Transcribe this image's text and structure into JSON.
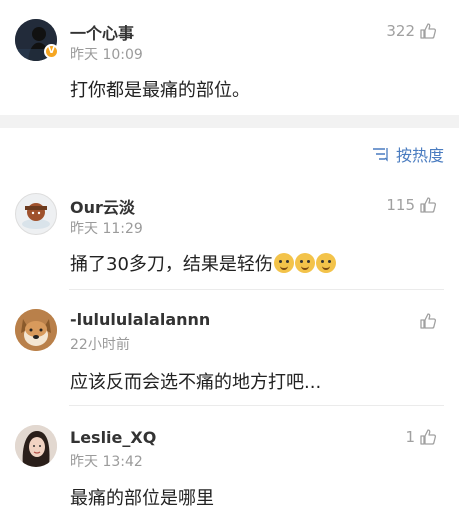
{
  "post": {
    "author": "一个心事",
    "time": "昨天 10:09",
    "likes": "322",
    "text": "打你都是最痛的部位。"
  },
  "sort": {
    "label": "按热度"
  },
  "comments": [
    {
      "author": "Our云淡",
      "time": "昨天 11:29",
      "likes": "115",
      "text": "捅了30多刀，结果是轻伤"
    },
    {
      "author": "-lulululalalannn",
      "time": "22小时前",
      "likes": "",
      "text": "应该反而会选不痛的地方打吧..."
    },
    {
      "author": "Leslie_XQ",
      "time": "昨天 13:42",
      "likes": "1",
      "text": "最痛的部位是哪里"
    }
  ],
  "icons": {
    "like": "thumbs-up-icon",
    "sort": "sort-lines-icon",
    "verified": "verified-v-badge-icon"
  },
  "colors": {
    "accent": "#4a7cc0",
    "badge": "#f5a623"
  }
}
